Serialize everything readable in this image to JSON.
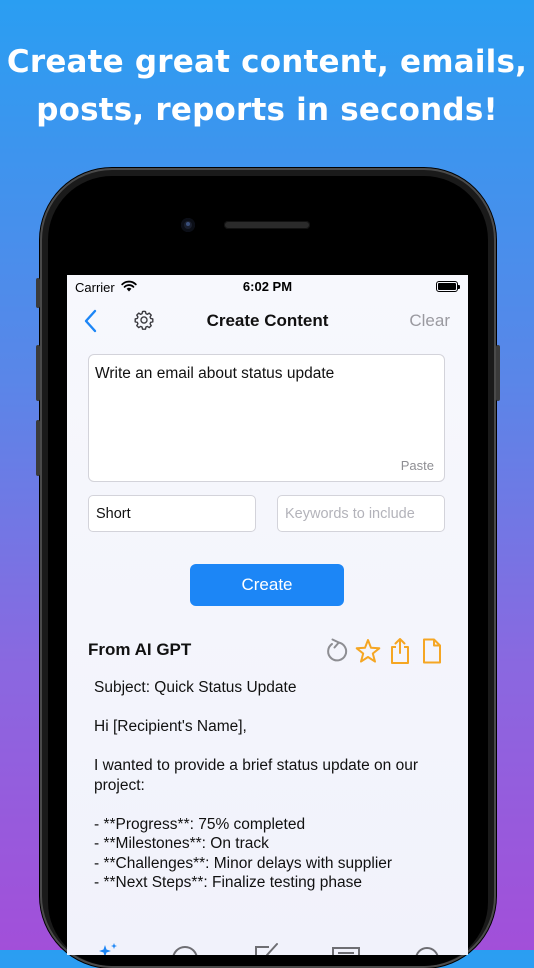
{
  "headline": {
    "line1": "Create great content, emails,",
    "line2": "posts, reports in seconds!"
  },
  "status_bar": {
    "carrier": "Carrier",
    "time": "6:02 PM"
  },
  "nav": {
    "title": "Create Content",
    "clear_label": "Clear",
    "back_icon": "chevron-left-icon",
    "settings_icon": "gear-icon"
  },
  "prompt": {
    "value": "Write an email about status update",
    "paste_label": "Paste"
  },
  "length": {
    "value": "Short"
  },
  "keywords": {
    "placeholder": "Keywords to include",
    "value": ""
  },
  "create_label": "Create",
  "result": {
    "title": "From AI GPT",
    "actions": [
      "regenerate-icon",
      "star-icon",
      "share-icon",
      "document-icon"
    ],
    "subject": "Subject: Quick Status Update",
    "greeting": "Hi [Recipient's Name],",
    "intro": "I wanted to provide a brief status update on our project:",
    "bullets": [
      "- **Progress**: 75% completed",
      "- **Milestones**: On track",
      "- **Challenges**: Minor delays with supplier",
      "- **Next Steps**: Finalize testing phase"
    ]
  },
  "colors": {
    "accent": "#1c86f6",
    "action_orange": "#f5a623",
    "muted": "#9a9aa0"
  },
  "tabbar_icons": [
    "sparkles-icon",
    "chat-icon",
    "compose-icon",
    "image-icon",
    "more-icon"
  ]
}
